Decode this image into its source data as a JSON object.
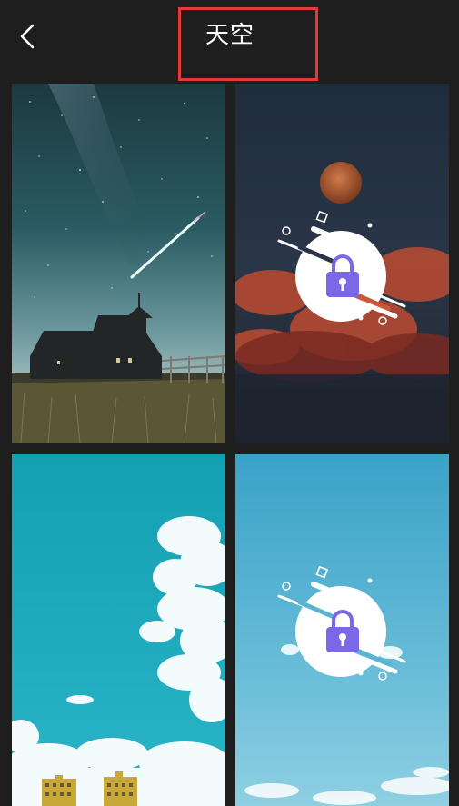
{
  "header": {
    "title": "天空",
    "back_icon": "chevron-left-icon",
    "highlight_color": "#e53935"
  },
  "wallpapers": [
    {
      "name": "milky-way-church",
      "locked": false
    },
    {
      "name": "red-clouds-moon",
      "locked": true,
      "lock_icon": "lock-icon"
    },
    {
      "name": "blue-sky-clouds-buildings",
      "locked": false
    },
    {
      "name": "light-blue-sky",
      "locked": true,
      "lock_icon": "lock-icon"
    }
  ],
  "colors": {
    "background": "#1e1e1e",
    "lock_accent": "#7b68e8"
  }
}
